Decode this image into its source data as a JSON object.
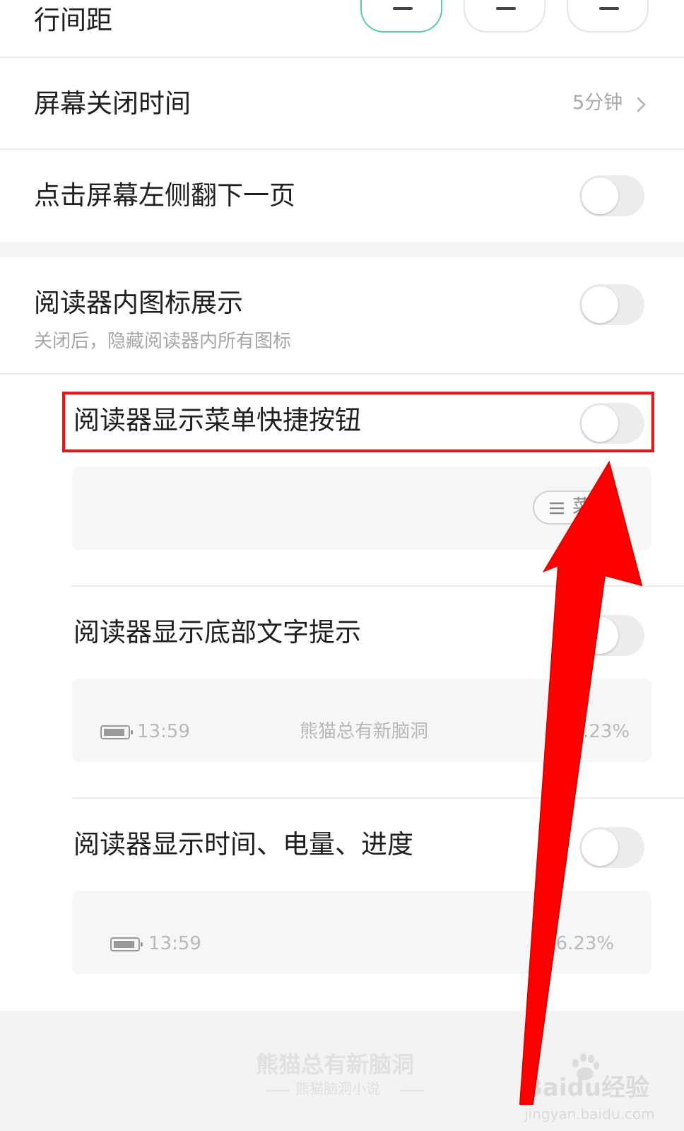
{
  "line_spacing": {
    "label": "行间距"
  },
  "screen_off": {
    "label": "屏幕关闭时间",
    "value": "5分钟"
  },
  "tap_left": {
    "label": "点击屏幕左侧翻下一页",
    "enabled": false
  },
  "reader_icons": {
    "label": "阅读器内图标展示",
    "description": "关闭后，隐藏阅读器内所有图标",
    "enabled": false
  },
  "menu_shortcut": {
    "label": "阅读器显示菜单快捷按钮",
    "enabled": false,
    "preview_chip": "菜"
  },
  "bottom_hint": {
    "label": "阅读器显示底部文字提示",
    "enabled": false,
    "preview_time": "13:59",
    "preview_title": "熊猫总有新脑洞",
    "preview_progress": "66.23%"
  },
  "time_battery": {
    "label": "阅读器显示时间、电量、进度",
    "enabled": false,
    "preview_time": "13:59",
    "preview_progress": "66.23%"
  },
  "footer": {
    "title": "熊猫总有新脑洞",
    "subtitle": "熊猫脑洞小说"
  },
  "watermark": {
    "brand": "Baidu经验",
    "url": "jingyan.baidu.com"
  },
  "colors": {
    "accent": "#5cc8a6",
    "highlight_box": "#e0191e",
    "arrow": "#ff0000"
  }
}
